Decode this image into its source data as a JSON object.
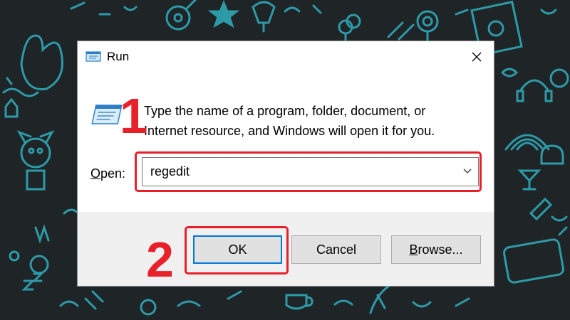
{
  "window": {
    "title": "Run",
    "icon": "run-icon",
    "close_icon": "close-icon"
  },
  "description": {
    "line1": "Type the name of a program, folder, document, or",
    "line2": "Internet resource, and Windows will open it for you."
  },
  "open_field": {
    "label_prefix": "",
    "label_accel": "O",
    "label_rest": "pen:",
    "value": "regedit",
    "dropdown_icon": "chevron-down-icon"
  },
  "buttons": {
    "ok": "OK",
    "cancel": "Cancel",
    "browse_accel": "B",
    "browse_rest": "rowse..."
  },
  "annotations": {
    "step1": "1",
    "step2": "2",
    "highlight_color": "#e8202a"
  },
  "colors": {
    "wallpaper": "#1f2427",
    "doodle": "#2fa7b6",
    "button_face": "#e1e1e1",
    "button_bar": "#f0f0f0",
    "focus_border": "#0078d7"
  }
}
